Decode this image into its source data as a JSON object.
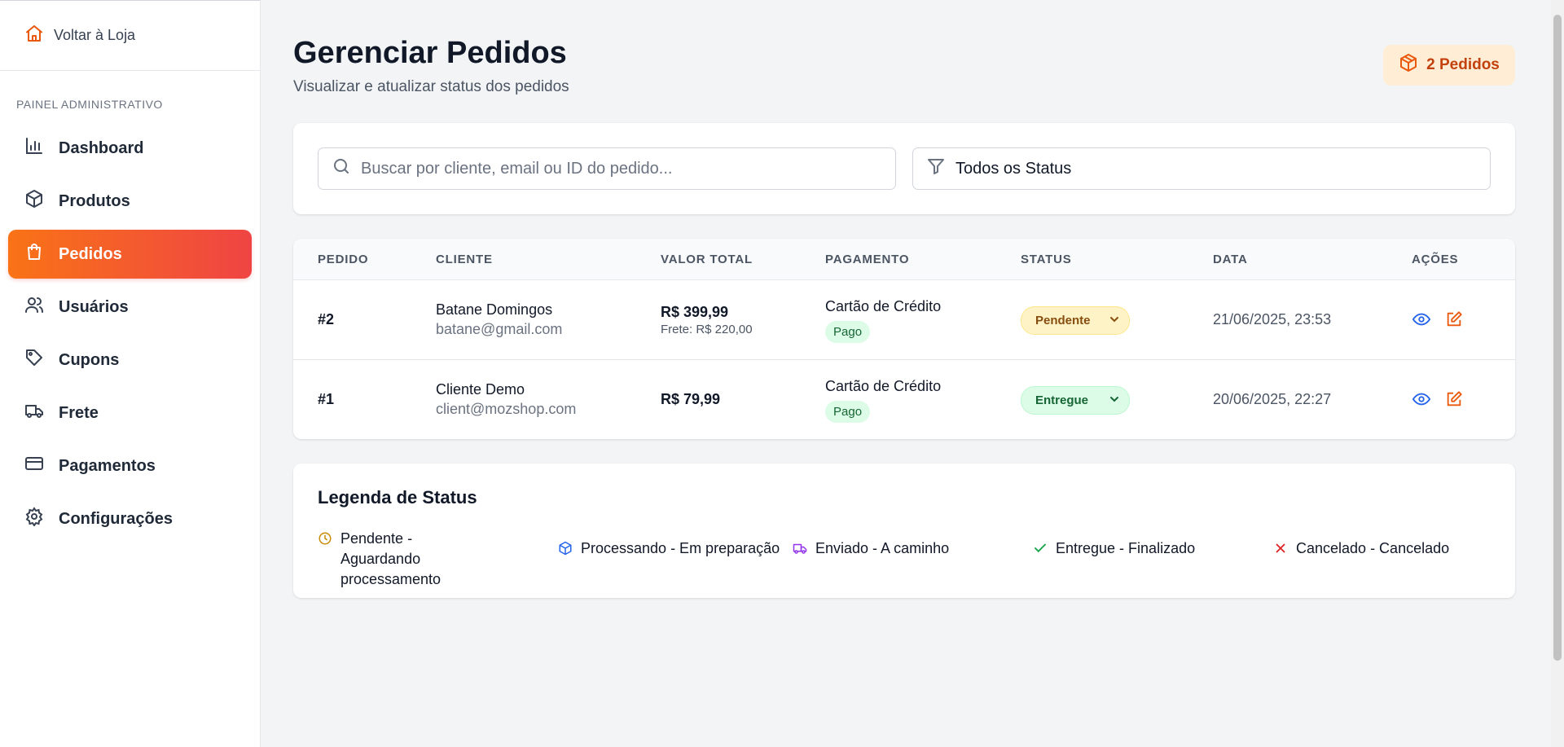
{
  "sidebar": {
    "back_label": "Voltar à Loja",
    "section_title": "PAINEL ADMINISTRATIVO",
    "items": [
      {
        "label": "Dashboard",
        "icon": "bar-chart-icon"
      },
      {
        "label": "Produtos",
        "icon": "package-icon"
      },
      {
        "label": "Pedidos",
        "icon": "shopping-bag-icon",
        "active": true
      },
      {
        "label": "Usuários",
        "icon": "users-icon"
      },
      {
        "label": "Cupons",
        "icon": "tag-icon"
      },
      {
        "label": "Frete",
        "icon": "truck-icon"
      },
      {
        "label": "Pagamentos",
        "icon": "credit-card-icon"
      },
      {
        "label": "Configurações",
        "icon": "gear-icon"
      }
    ]
  },
  "header": {
    "title": "Gerenciar Pedidos",
    "subtitle": "Visualizar e atualizar status dos pedidos",
    "count_badge": "2 Pedidos"
  },
  "filters": {
    "search_placeholder": "Buscar por cliente, email ou ID do pedido...",
    "status_value": "Todos os Status"
  },
  "table": {
    "columns": [
      "PEDIDO",
      "CLIENTE",
      "VALOR TOTAL",
      "PAGAMENTO",
      "STATUS",
      "DATA",
      "AÇÕES"
    ],
    "rows": [
      {
        "id": "#2",
        "customer_name": "Batane Domingos",
        "customer_email": "batane@gmail.com",
        "total": "R$ 399,99",
        "freight": "Frete: R$ 220,00",
        "payment_method": "Cartão de Crédito",
        "payment_status": "Pago",
        "status": "Pendente",
        "date": "21/06/2025, 23:53"
      },
      {
        "id": "#1",
        "customer_name": "Cliente Demo",
        "customer_email": "client@mozshop.com",
        "total": "R$ 79,99",
        "freight": "",
        "payment_method": "Cartão de Crédito",
        "payment_status": "Pago",
        "status": "Entregue",
        "date": "20/06/2025, 22:27"
      }
    ]
  },
  "legend": {
    "title": "Legenda de Status",
    "items": [
      {
        "label": "Pendente - Aguardando processamento",
        "icon": "clock-icon",
        "color": "#ca8a04"
      },
      {
        "label": "Processando - Em preparação",
        "icon": "package-icon",
        "color": "#2563eb"
      },
      {
        "label": "Enviado - A caminho",
        "icon": "truck-icon",
        "color": "#9333ea"
      },
      {
        "label": "Entregue - Finalizado",
        "icon": "check-icon",
        "color": "#16a34a"
      },
      {
        "label": "Cancelado - Cancelado",
        "icon": "x-icon",
        "color": "#dc2626"
      }
    ]
  },
  "colors": {
    "accent_start": "#f97316",
    "accent_end": "#ef4444",
    "view_icon": "#2563eb",
    "edit_icon": "#ea580c"
  }
}
